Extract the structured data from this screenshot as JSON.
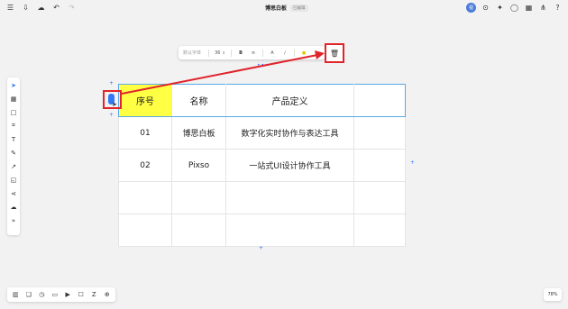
{
  "topbar": {
    "doc_title": "博思白板",
    "status_badge": "已编辑",
    "avatar_text": "视"
  },
  "float_toolbar": {
    "font_select": "默认字体",
    "font_size": "36",
    "bold": "B"
  },
  "table": {
    "header": [
      "序号",
      "名称",
      "产品定义",
      ""
    ],
    "rows": [
      [
        "01",
        "博思白板",
        "数字化实时协作与表达工具",
        ""
      ],
      [
        "02",
        "Pixso",
        "一站式UI设计协作工具",
        ""
      ],
      [
        "",
        "",
        "",
        ""
      ],
      [
        "",
        "",
        "",
        ""
      ]
    ]
  },
  "zoom": {
    "level": "78%"
  },
  "colors": {
    "accent": "#3478f6",
    "highlight": "#e0242a",
    "cell_fill": "#ffff44"
  }
}
